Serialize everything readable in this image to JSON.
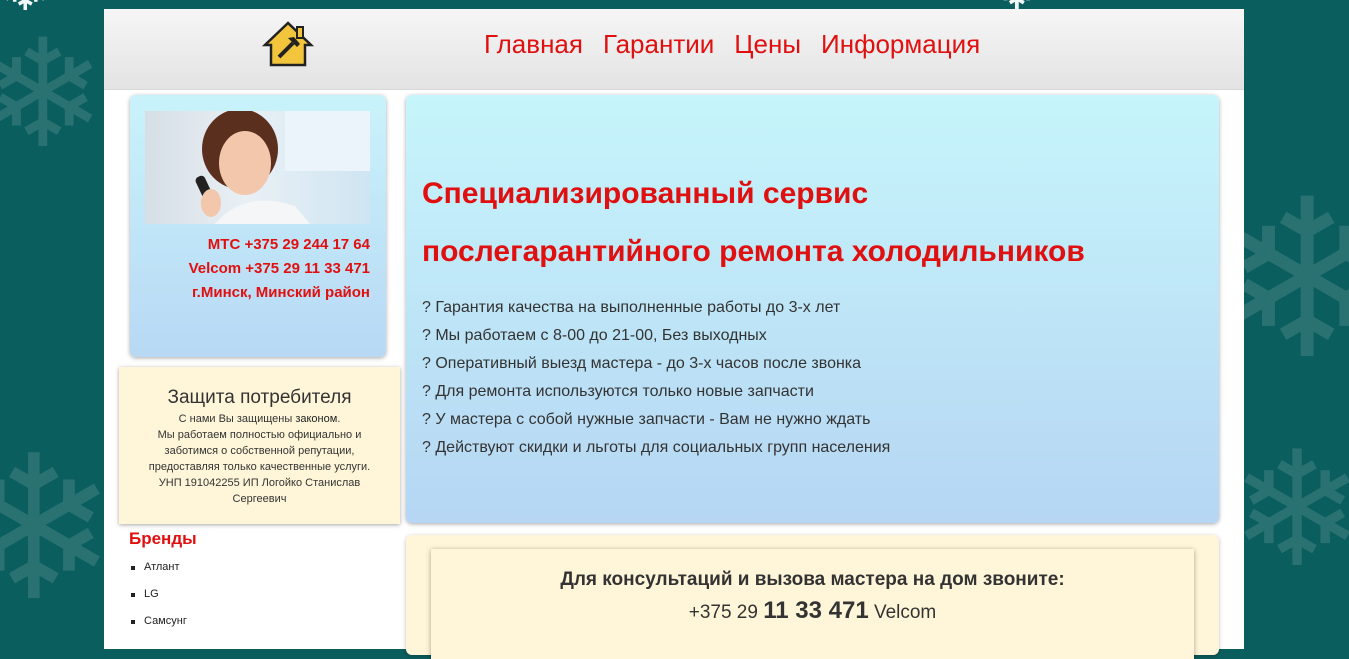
{
  "nav": {
    "items": [
      "Главная",
      "Гарантии",
      "Цены",
      "Информация"
    ]
  },
  "contact": {
    "mts": "МТС +375 29 244 17 64",
    "velcom": "Velcom +375 29 11 33 471",
    "location": "г.Минск, Минский район"
  },
  "consumer": {
    "title": "Защита потребителя",
    "line1_prefix": "С нами Вы защищены ",
    "line1_link": "законом",
    "line1_suffix": ".",
    "line2": "Мы работаем полностью официально и заботимся о собственной репутации, предоставляя только качественные услуги.",
    "line3": "УНП 191042255 ИП Логойко Станислав Сергеевич"
  },
  "brands": {
    "title": "Бренды",
    "items": [
      "Атлант",
      "LG",
      "Самсунг"
    ]
  },
  "hero": {
    "title_line1": "Специализированный сервис",
    "title_line2": "послегарантийного ремонта холодильников",
    "features": [
      "? Гарантия качества на выполненные работы до 3-х лет",
      "? Мы работаем с 8-00 до 21-00, Без выходных",
      "? Оперативный выезд мастера - до 3-х часов после звонка",
      "? Для ремонта используются только новые запчасти",
      "? У мастера с собой нужные запчасти - Вам не нужно ждать",
      "? Действуют скидки и льготы для социальных групп населения"
    ]
  },
  "call": {
    "title": "Для консультаций и вызова мастера на дом звоните:",
    "phone_prefix": "+375 29 ",
    "phone_main": "11 33 471",
    "phone_operator": " Velcom"
  },
  "colors": {
    "accent_red": "#e01010",
    "background": "#0b5e5e",
    "hero_bg": "#c6f5fb",
    "cream": "#fff6d9"
  }
}
